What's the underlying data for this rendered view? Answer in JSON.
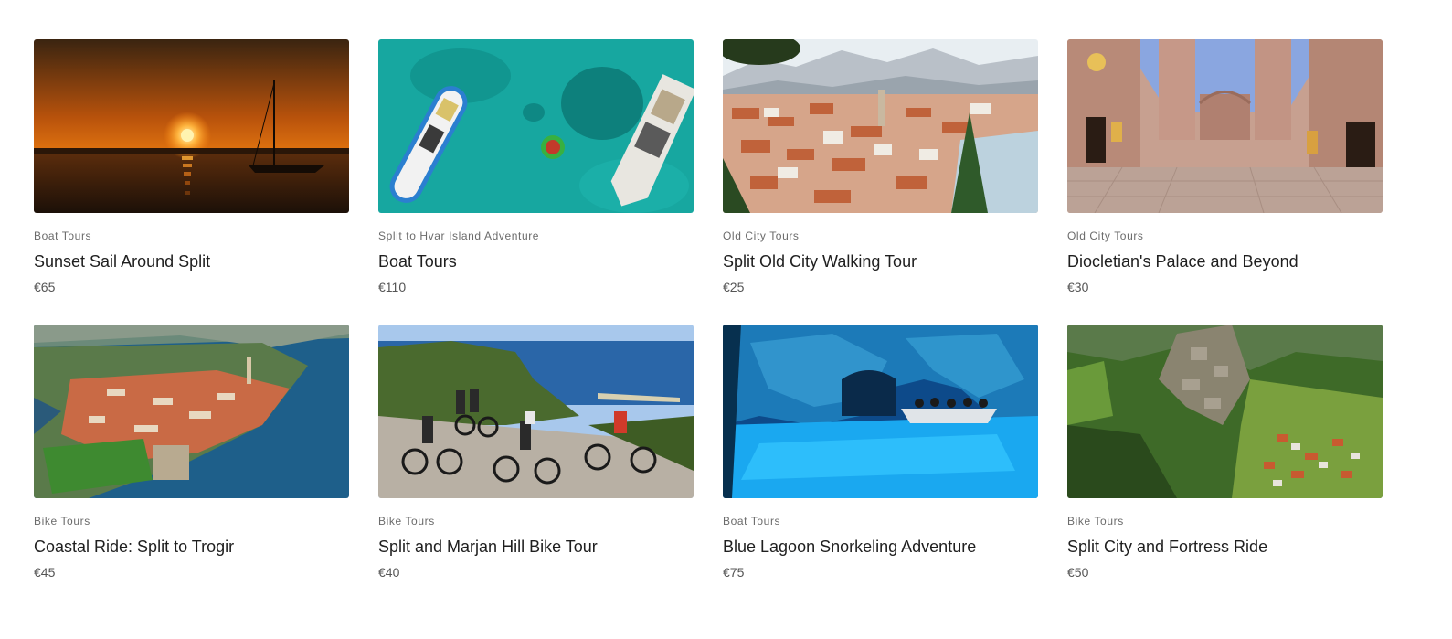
{
  "tours": [
    {
      "category": "Boat Tours",
      "title": "Sunset Sail Around Split",
      "price": "€65",
      "image": "sunset-sailboat-image"
    },
    {
      "category": "Split to Hvar Island Adventure",
      "title": "Boat Tours",
      "price": "€110",
      "image": "aerial-boats-turquoise-sea-image"
    },
    {
      "category": "Old City Tours",
      "title": "Split Old City Walking Tour",
      "price": "€25",
      "image": "split-city-panorama-image"
    },
    {
      "category": "Old City Tours",
      "title": "Diocletian's Palace and Beyond",
      "price": "€30",
      "image": "palace-peristyle-square-image"
    },
    {
      "category": "Bike Tours",
      "title": "Coastal Ride: Split to Trogir",
      "price": "€45",
      "image": "trogir-aerial-coast-image"
    },
    {
      "category": "Bike Tours",
      "title": "Split and Marjan Hill Bike Tour",
      "price": "€40",
      "image": "cyclists-on-hill-road-image"
    },
    {
      "category": "Boat Tours",
      "title": "Blue Lagoon Snorkeling Adventure",
      "price": "€75",
      "image": "blue-cave-boat-image"
    },
    {
      "category": "Bike Tours",
      "title": "Split City and Fortress Ride",
      "price": "€50",
      "image": "fortress-hillside-aerial-image"
    }
  ]
}
